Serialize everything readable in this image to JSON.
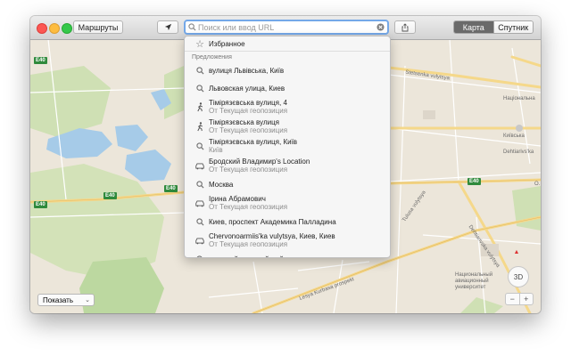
{
  "toolbar": {
    "directions_label": "Маршруты",
    "search_placeholder": "Поиск или ввод URL",
    "view_map_label": "Карта",
    "view_satellite_label": "Спутник"
  },
  "dropdown": {
    "favorites_label": "Избранное",
    "suggestions_header": "Предложения",
    "items": [
      {
        "title": "вулиця Львівська, Київ",
        "subtitle": "",
        "icon": "search-icon"
      },
      {
        "title": "Львовская улица, Киев",
        "subtitle": "",
        "icon": "search-icon"
      },
      {
        "title": "Тімірязєвська вулиця, 4",
        "subtitle": "От Текущая геопозиция",
        "icon": "walk-icon"
      },
      {
        "title": "Тімірязєвська вулиця",
        "subtitle": "От Текущая геопозиция",
        "icon": "walk-icon"
      },
      {
        "title": "Тімірязєвська вулиця, Київ",
        "subtitle": "Київ",
        "icon": "search-icon"
      },
      {
        "title": "Бродский Владимир's Location",
        "subtitle": "От Текущая геопозиция",
        "icon": "car-icon"
      },
      {
        "title": "Москва",
        "subtitle": "",
        "icon": "search-icon"
      },
      {
        "title": "Ірина Абрамович",
        "subtitle": "От Текущая геопозиция",
        "icon": "car-icon"
      },
      {
        "title": "Киев, проспект Академика Палладина",
        "subtitle": "",
        "icon": "search-icon"
      },
      {
        "title": "Chervonoarmiis'ka vulytsya, Киев, Киев",
        "subtitle": "От Текущая геопозиция",
        "icon": "car-icon"
      },
      {
        "title": "киевский олимпийский стадион",
        "subtitle": "",
        "icon": "search-icon"
      }
    ]
  },
  "map": {
    "road_shield": "E40",
    "labels": {
      "stetsenka": "Stetsenka vulytsya",
      "tulusa": "Tulusa vulytsya",
      "dehtiarivska": "Dehtiarivska vulytsya",
      "prospekt": "Lesya Kurbasa prospekt",
      "university": "Национальный авиационный университет",
      "kyivska": "Київська",
      "bdz": "Dehtiarivs'ka",
      "na": "Національна",
      "o": "О."
    },
    "show_label": "Показать",
    "three_d_label": "3D",
    "zoom_out_label": "−",
    "zoom_in_label": "+"
  }
}
